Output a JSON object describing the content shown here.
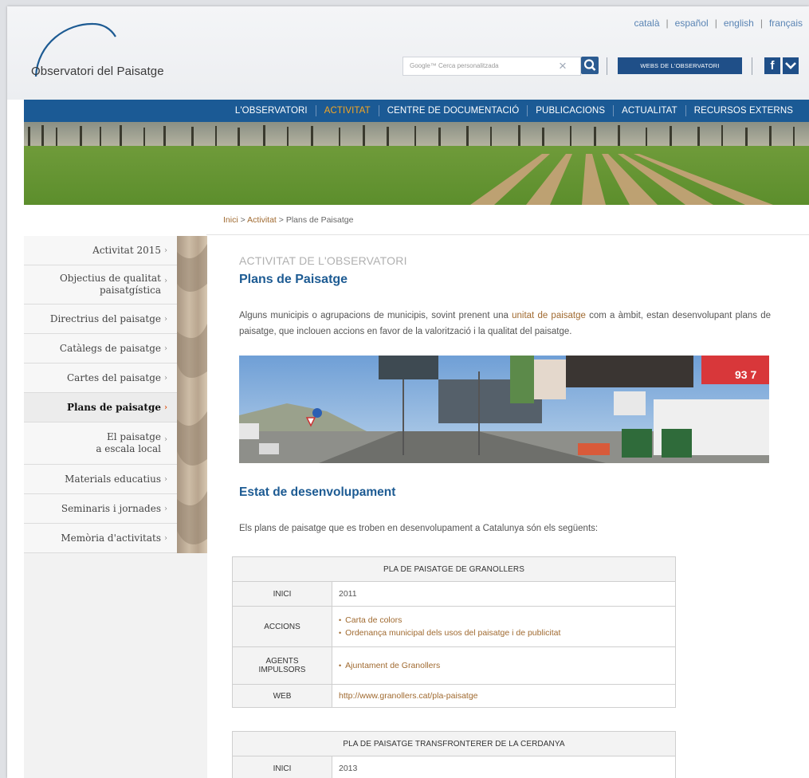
{
  "header": {
    "logo_text": "Observatori del Paisatge",
    "languages": [
      "català",
      "español",
      "english",
      "français"
    ],
    "search_placeholder": "Google™ Cerca personalitzada",
    "webs_button": "WEBS DE L'OBSERVATORI",
    "facebook": "f"
  },
  "nav": {
    "items": [
      "L'OBSERVATORI",
      "ACTIVITAT",
      "CENTRE DE DOCUMENTACIÓ",
      "PUBLICACIONS",
      "ACTUALITAT",
      "RECURSOS EXTERNS"
    ],
    "active": "ACTIVITAT"
  },
  "breadcrumb": {
    "items": [
      "Inici",
      "Activitat",
      "Plans de Paisatge"
    ],
    "separator": " > "
  },
  "sidebar": {
    "items": [
      {
        "label": "Activitat 2015"
      },
      {
        "label": "Objectius de qualitat",
        "label2": "paisatgística"
      },
      {
        "label": "Directrius del paisatge"
      },
      {
        "label": "Catàlegs de paisatge"
      },
      {
        "label": "Cartes del paisatge"
      },
      {
        "label": "Plans de paisatge"
      },
      {
        "label": "El paisatge",
        "label2": "a escala local"
      },
      {
        "label": "Materials educatius"
      },
      {
        "label": "Seminaris i jornades"
      },
      {
        "label": "Memòria d'activitats"
      }
    ],
    "active": "Plans de paisatge"
  },
  "content": {
    "section_label": "ACTIVITAT DE L'OBSERVATORI",
    "title": "Plans de Paisatge",
    "intro_1": "Alguns municipis o agrupacions de municipis, sovint prenent una ",
    "intro_link": "unitat de paisatge",
    "intro_2": " com a àmbit, estan desenvolupant plans de paisatge, que inclouen accions en favor de la valorització i la qualitat del paisatge.",
    "photo_sign": "93 7",
    "heading2": "Estat de desenvolupament",
    "paragraph2": "Els plans de paisatge que es troben en desenvolupament a Catalunya són els següents:"
  },
  "table1": {
    "title": "PLA DE PAISATGE DE GRANOLLERS",
    "inici_label": "INICI",
    "inici": "2011",
    "accions_label": "ACCIONS",
    "accions": [
      "Carta de colors",
      "Ordenança municipal dels usos del paisatge i de publicitat"
    ],
    "agents_label_1": "AGENTS",
    "agents_label_2": "IMPULSORS",
    "agents": [
      "Ajuntament de Granollers"
    ],
    "web_label": "WEB",
    "web": "http://www.granollers.cat/pla-paisatge"
  },
  "table2": {
    "title": "PLA DE PAISATGE TRANSFRONTERER DE LA CERDANYA",
    "inici_label": "INICI",
    "inici": "2013"
  },
  "colors": {
    "nav_bg": "#1b5a95",
    "nav_active": "#f5a623",
    "link": "#a06a30",
    "title": "#1d5b93"
  }
}
